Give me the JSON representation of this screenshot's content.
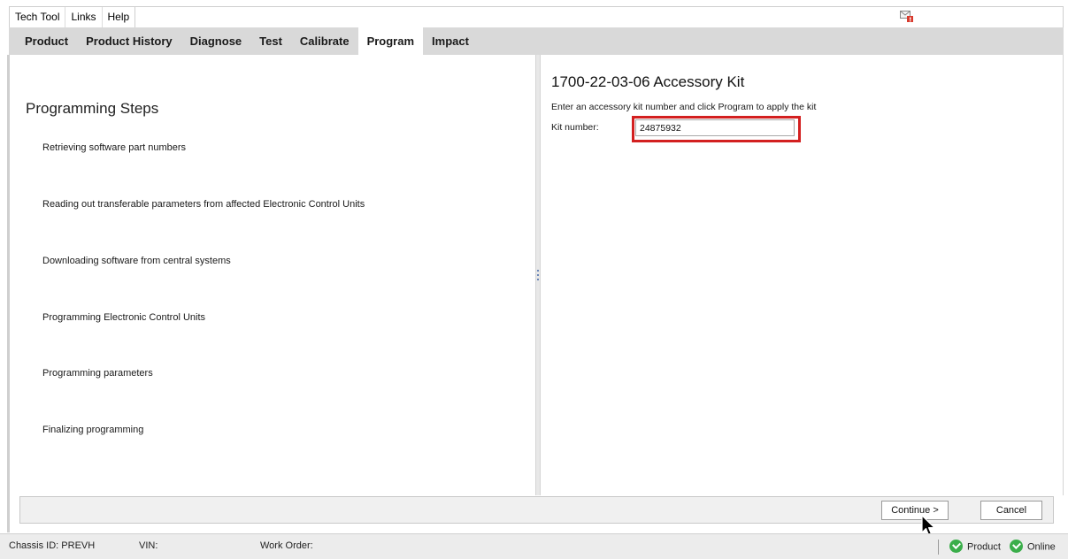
{
  "menu": {
    "items": [
      "Tech Tool",
      "Links",
      "Help"
    ]
  },
  "tabs": {
    "items": [
      "Product",
      "Product History",
      "Diagnose",
      "Test",
      "Calibrate",
      "Program",
      "Impact"
    ],
    "active": "Program"
  },
  "programming": {
    "title": "Programming Steps",
    "steps": [
      "Retrieving software part numbers",
      "Reading out transferable parameters from affected Electronic Control Units",
      "Downloading software from central systems",
      "Programming Electronic Control Units",
      "Programming parameters",
      "Finalizing programming"
    ]
  },
  "kit": {
    "title": "1700-22-03-06 Accessory Kit",
    "instruction": "Enter an accessory kit number and click Program to apply the kit",
    "label": "Kit number:",
    "value": "24875932"
  },
  "buttons": {
    "continue": "Continue >",
    "cancel": "Cancel"
  },
  "status": {
    "chassis": "Chassis ID: PREVH",
    "vin": "VIN:",
    "work_order": "Work Order:",
    "product": "Product",
    "online": "Online"
  },
  "colors": {
    "tabbar_bg": "#d9d9d9",
    "highlight_border": "#d32020",
    "status_ok": "#3aae4a"
  },
  "icons": {
    "notification": "message-alert-icon",
    "cursor": "mouse-pointer-icon",
    "status_ok": "check-circle-icon"
  }
}
